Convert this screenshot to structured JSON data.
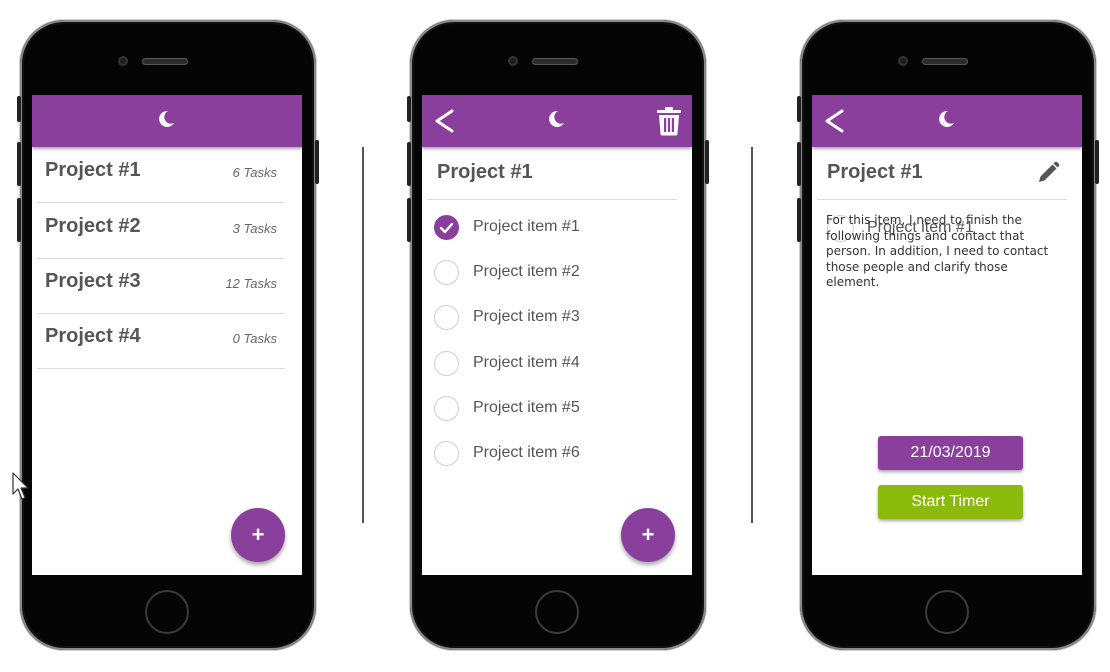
{
  "colors": {
    "accent": "#8a3f9c",
    "timer": "#8cba0c",
    "text": "#555555"
  },
  "screen1": {
    "projects": [
      {
        "name": "Project #1",
        "count": "6 Tasks"
      },
      {
        "name": "Project #2",
        "count": "3 Tasks"
      },
      {
        "name": "Project #3",
        "count": "12 Tasks"
      },
      {
        "name": "Project #4",
        "count": "0 Tasks"
      }
    ],
    "fab_label": "+"
  },
  "screen2": {
    "title": "Project #1",
    "items": [
      {
        "label": "Project item #1",
        "checked": true
      },
      {
        "label": "Project item #2",
        "checked": false
      },
      {
        "label": "Project item #3",
        "checked": false
      },
      {
        "label": "Project item #4",
        "checked": false
      },
      {
        "label": "Project item #5",
        "checked": false
      },
      {
        "label": "Project item #6",
        "checked": false
      }
    ],
    "fab_label": "+"
  },
  "screen3": {
    "title": "Project #1",
    "item_label": "Project item #1",
    "description": "For this item, I need to finish the following things and contact that person. In addition, I need to contact those people and clarify those element.",
    "date": "21/03/2019",
    "timer_label": "Start Timer"
  },
  "icons": {
    "moon": "moon-icon",
    "back": "back-arrow-icon",
    "trash": "trash-icon",
    "edit": "pencil-icon",
    "check": "check-icon"
  }
}
